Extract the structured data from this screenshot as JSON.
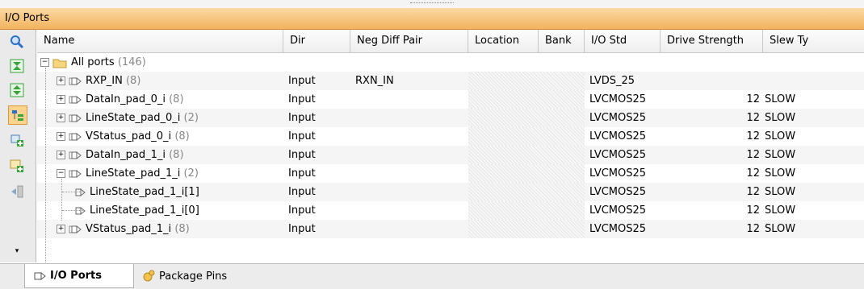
{
  "window": {
    "title": "I/O Ports"
  },
  "toolbar": {
    "icons": [
      "search-icon",
      "collapse-all-icon",
      "expand-all-icon",
      "group-by-icon",
      "create-port-icon",
      "create-interface-icon",
      "auto-place-icon",
      "more-icon"
    ]
  },
  "table": {
    "columns": [
      "Name",
      "Dir",
      "Neg Diff Pair",
      "Location",
      "Bank",
      "I/O Std",
      "Drive Strength",
      "Slew Ty"
    ],
    "root": {
      "label": "All ports",
      "count": "(146)"
    },
    "rows": [
      {
        "name": "RXP_IN",
        "count": "(8)",
        "dir": "Input",
        "neg": "RXN_IN",
        "std": "LVDS_25",
        "drive": "",
        "slew": ""
      },
      {
        "name": "DataIn_pad_0_i",
        "count": "(8)",
        "dir": "Input",
        "neg": "",
        "std": "LVCMOS25",
        "drive": "12",
        "slew": "SLOW"
      },
      {
        "name": "LineState_pad_0_i",
        "count": "(2)",
        "dir": "Input",
        "neg": "",
        "std": "LVCMOS25",
        "drive": "12",
        "slew": "SLOW"
      },
      {
        "name": "VStatus_pad_0_i",
        "count": "(8)",
        "dir": "Input",
        "neg": "",
        "std": "LVCMOS25",
        "drive": "12",
        "slew": "SLOW"
      },
      {
        "name": "DataIn_pad_1_i",
        "count": "(8)",
        "dir": "Input",
        "neg": "",
        "std": "LVCMOS25",
        "drive": "12",
        "slew": "SLOW"
      },
      {
        "name": "LineState_pad_1_i",
        "count": "(2)",
        "dir": "Input",
        "neg": "",
        "std": "LVCMOS25",
        "drive": "12",
        "slew": "SLOW"
      },
      {
        "name": "LineState_pad_1_i[1]",
        "count": "",
        "dir": "Input",
        "neg": "",
        "std": "LVCMOS25",
        "drive": "12",
        "slew": "SLOW"
      },
      {
        "name": "LineState_pad_1_i[0]",
        "count": "",
        "dir": "Input",
        "neg": "",
        "std": "LVCMOS25",
        "drive": "12",
        "slew": "SLOW"
      },
      {
        "name": "VStatus_pad_1_i",
        "count": "(8)",
        "dir": "Input",
        "neg": "",
        "std": "LVCMOS25",
        "drive": "12",
        "slew": "SLOW"
      }
    ]
  },
  "tabs": {
    "io_ports": "I/O Ports",
    "package_pins": "Package Pins"
  },
  "colors": {
    "title_bar": "#f2b35e",
    "icon_green": "#3aa33a",
    "icon_blue": "#2a6fc9"
  }
}
